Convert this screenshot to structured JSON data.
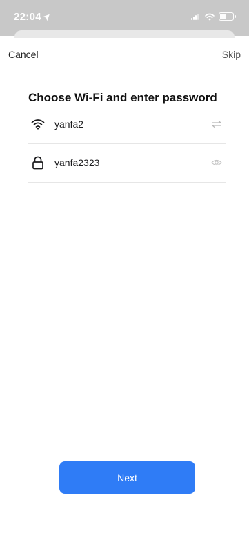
{
  "status_bar": {
    "time": "22:04",
    "color": "#c8c8c8"
  },
  "nav": {
    "cancel_label": "Cancel",
    "skip_label": "Skip"
  },
  "title": "Choose Wi-Fi and enter password",
  "wifi": {
    "ssid": "yanfa2",
    "icon": "wifi-icon",
    "action_icon": "switch-network-icon"
  },
  "password": {
    "value": "yanfa2323",
    "icon": "lock-icon",
    "action_icon": "eye-icon"
  },
  "next_button": {
    "label": "Next",
    "color": "#2f7cf6"
  }
}
